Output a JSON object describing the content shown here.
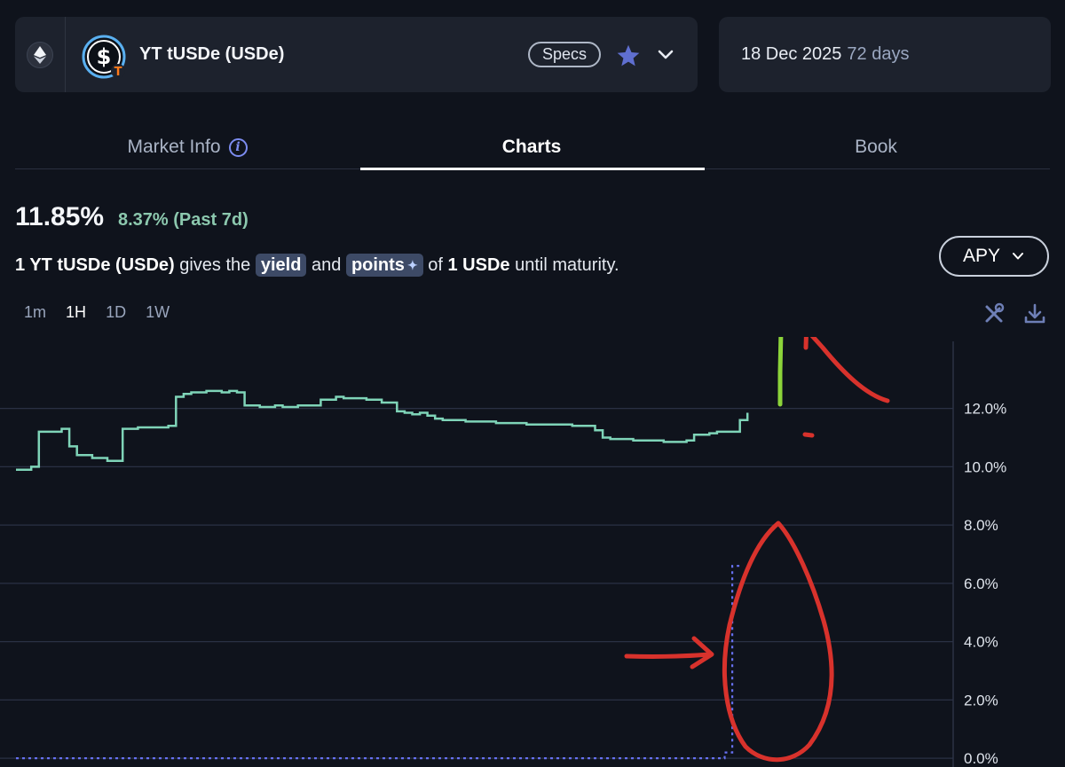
{
  "header": {
    "chain_icon": "ethereum-icon",
    "token_icon": "dollar-coin-icon",
    "market_name": "YT tUSDe (USDe)",
    "specs_label": "Specs",
    "favorite_icon": "star-icon",
    "expand_icon": "chevron-down-icon"
  },
  "maturity": {
    "date": "18 Dec 2025",
    "days_left": "72 days"
  },
  "tabs": [
    {
      "label": "Market Info",
      "icon": "info-icon"
    },
    {
      "label": "Charts"
    },
    {
      "label": "Book"
    }
  ],
  "summary": {
    "current_apy": "11.85%",
    "past_7d": "8.37% (Past 7d)",
    "desc_amount": "1 YT tUSDe (USDe)",
    "desc_mid": "gives the",
    "desc_yield": "yield",
    "desc_and": "and",
    "desc_points": "points",
    "desc_of": "of",
    "desc_underlying": "1 USDe",
    "desc_end": "until maturity."
  },
  "metric_select": {
    "value": "APY",
    "icon": "chevron-down-icon"
  },
  "timeframes": [
    "1m",
    "1H",
    "1D",
    "1W"
  ],
  "active_timeframe": "1H",
  "tools": {
    "indicator_icon": "tools-icon",
    "download_icon": "download-icon"
  },
  "colors": {
    "implied_apy": "#7fd4b8",
    "underlying_dotted": "#6670f0",
    "annotation_red": "#d8322c",
    "annotation_green": "#8cd43a",
    "accent": "#7c8cf0"
  },
  "chart_data": {
    "type": "line",
    "y_unit": "%",
    "ylim": [
      -0.3,
      14.3
    ],
    "y_ticks": [
      "12.0%",
      "10.0%",
      "8.0%",
      "6.0%",
      "4.0%",
      "2.0%",
      "0.0%"
    ],
    "x_count": 100,
    "series": [
      {
        "style": "solid",
        "points": [
          [
            0,
            9.9
          ],
          [
            1,
            9.9
          ],
          [
            2,
            10.0
          ],
          [
            3,
            11.2
          ],
          [
            4,
            11.2
          ],
          [
            5,
            11.2
          ],
          [
            6,
            11.3
          ],
          [
            7,
            10.7
          ],
          [
            8,
            10.4
          ],
          [
            9,
            10.4
          ],
          [
            10,
            10.3
          ],
          [
            11,
            10.3
          ],
          [
            12,
            10.2
          ],
          [
            13,
            10.2
          ],
          [
            14,
            11.3
          ],
          [
            15,
            11.3
          ],
          [
            16,
            11.35
          ],
          [
            17,
            11.35
          ],
          [
            18,
            11.35
          ],
          [
            19,
            11.35
          ],
          [
            20,
            11.4
          ],
          [
            21,
            12.4
          ],
          [
            22,
            12.5
          ],
          [
            23,
            12.55
          ],
          [
            24,
            12.55
          ],
          [
            25,
            12.6
          ],
          [
            26,
            12.6
          ],
          [
            27,
            12.55
          ],
          [
            28,
            12.6
          ],
          [
            29,
            12.55
          ],
          [
            30,
            12.1
          ],
          [
            31,
            12.1
          ],
          [
            32,
            12.05
          ],
          [
            33,
            12.05
          ],
          [
            34,
            12.1
          ],
          [
            35,
            12.05
          ],
          [
            36,
            12.05
          ],
          [
            37,
            12.1
          ],
          [
            38,
            12.1
          ],
          [
            39,
            12.1
          ],
          [
            40,
            12.3
          ],
          [
            41,
            12.3
          ],
          [
            42,
            12.4
          ],
          [
            43,
            12.35
          ],
          [
            44,
            12.35
          ],
          [
            45,
            12.35
          ],
          [
            46,
            12.3
          ],
          [
            47,
            12.3
          ],
          [
            48,
            12.2
          ],
          [
            49,
            12.2
          ],
          [
            50,
            11.9
          ],
          [
            51,
            11.85
          ],
          [
            52,
            11.8
          ],
          [
            53,
            11.85
          ],
          [
            54,
            11.75
          ],
          [
            55,
            11.65
          ],
          [
            56,
            11.6
          ],
          [
            57,
            11.6
          ],
          [
            58,
            11.6
          ],
          [
            59,
            11.55
          ],
          [
            60,
            11.55
          ],
          [
            61,
            11.55
          ],
          [
            62,
            11.55
          ],
          [
            63,
            11.5
          ],
          [
            64,
            11.5
          ],
          [
            65,
            11.5
          ],
          [
            66,
            11.5
          ],
          [
            67,
            11.45
          ],
          [
            68,
            11.45
          ],
          [
            69,
            11.45
          ],
          [
            70,
            11.45
          ],
          [
            71,
            11.45
          ],
          [
            72,
            11.45
          ],
          [
            73,
            11.4
          ],
          [
            74,
            11.4
          ],
          [
            75,
            11.4
          ],
          [
            76,
            11.25
          ],
          [
            77,
            11.0
          ],
          [
            78,
            10.95
          ],
          [
            79,
            10.95
          ],
          [
            80,
            10.95
          ],
          [
            81,
            10.9
          ],
          [
            82,
            10.9
          ],
          [
            83,
            10.9
          ],
          [
            84,
            10.9
          ],
          [
            85,
            10.85
          ],
          [
            86,
            10.85
          ],
          [
            87,
            10.85
          ],
          [
            88,
            10.9
          ],
          [
            89,
            11.1
          ],
          [
            90,
            11.1
          ],
          [
            91,
            11.15
          ],
          [
            92,
            11.2
          ],
          [
            93,
            11.2
          ],
          [
            94,
            11.2
          ],
          [
            95,
            11.6
          ],
          [
            96,
            11.85
          ]
        ]
      },
      {
        "style": "dotted",
        "points": [
          [
            0,
            0
          ],
          [
            92,
            0
          ],
          [
            93,
            0.2
          ],
          [
            94,
            6.6
          ],
          [
            95,
            6.6
          ]
        ]
      }
    ]
  }
}
